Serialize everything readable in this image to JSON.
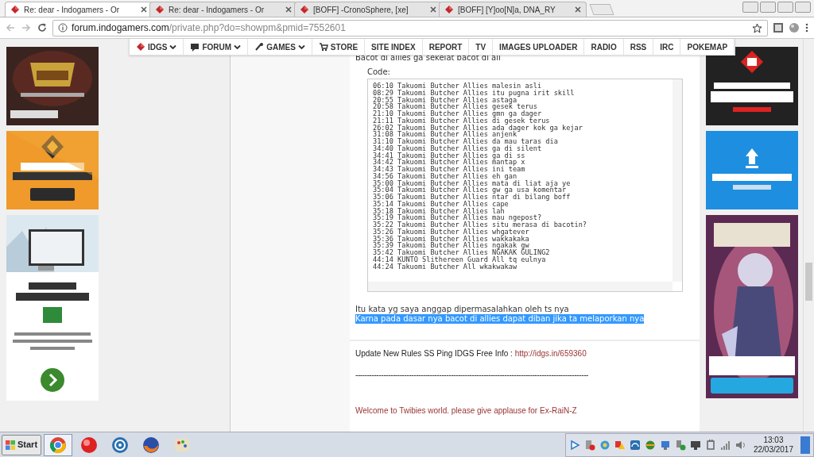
{
  "browser": {
    "tabs": [
      {
        "title": "Re: dear - Indogamers - Or",
        "selected": true
      },
      {
        "title": "Re: dear - Indogamers - Or",
        "selected": false
      },
      {
        "title": "[BOFF] -CronoSphere, [xe]",
        "selected": false
      },
      {
        "title": "[BOFF] [Y]oo[N]a, DNA_RY",
        "selected": false
      }
    ],
    "address": {
      "host": "forum.indogamers.com",
      "path": "/private.php?do=showpm&pmid=7552601"
    }
  },
  "nav": [
    {
      "label": "IDGS",
      "kind": "logo",
      "dropdown": true
    },
    {
      "label": "FORUM",
      "kind": "chat",
      "dropdown": true
    },
    {
      "label": "GAMES",
      "kind": "games",
      "dropdown": true
    },
    {
      "label": "STORE",
      "kind": "cart",
      "dropdown": false
    },
    {
      "label": "SITE INDEX",
      "kind": "plain",
      "dropdown": false
    },
    {
      "label": "REPORT",
      "kind": "plain",
      "dropdown": false
    },
    {
      "label": "TV",
      "kind": "plain",
      "dropdown": false
    },
    {
      "label": "IMAGES UPLOADER",
      "kind": "plain",
      "dropdown": false
    },
    {
      "label": "RADIO",
      "kind": "plain",
      "dropdown": false
    },
    {
      "label": "RSS",
      "kind": "plain",
      "dropdown": false
    },
    {
      "label": "IRC",
      "kind": "plain",
      "dropdown": false
    },
    {
      "label": "POKEMAP",
      "kind": "plain",
      "dropdown": false
    }
  ],
  "post": {
    "intro": "Bacot di allies ga sekelat bacot di all",
    "code_label": "Code:",
    "code_lines": [
      "06:10 Takuomi Butcher Allies malesin asli",
      "08:29 Takuomi Butcher Allies itu pugna irit skill",
      "20:55 Takuomi Butcher Allies astaga",
      "20:58 Takuomi Butcher Allies gesek terus",
      "21:10 Takuomi Butcher Allies gmn ga dager",
      "21:11 Takuomi Butcher Allies di gesek terus",
      "26:02 Takuomi Butcher Allies ada dager kok ga kejar",
      "31:08 Takuomi Butcher Allies anjenk",
      "31:10 Takuomi Butcher Allies da mau taras dia",
      "34:40 Takuomi Butcher Allies ga di silent",
      "34:41 Takuomi Butcher Allies ga di ss",
      "34:42 Takuomi Butcher Allies mantap x",
      "34:43 Takuomi Butcher Allies ini team",
      "34:56 Takuomi Butcher Allies eh gan",
      "35:00 Takuomi Butcher Allies mata di liat aja ye",
      "35:04 Takuomi Butcher Allies gw ga usa komentar",
      "35:06 Takuomi Butcher Allies ntar di bilang boff",
      "35:14 Takuomi Butcher Allies cape",
      "35:18 Takuomi Butcher Allies lah",
      "35:19 Takuomi Butcher Allies mau ngepost?",
      "35:22 Takuomi Butcher Allies situ merasa di bacotin?",
      "35:26 Takuomi Butcher Allies whgatever",
      "35:36 Takuomi Butcher Allies wakkakaka",
      "35:39 Takuomi Butcher Allies ngakak gw",
      "35:42 Takuomi Butcher Allies NGAKAK GULING2",
      "44:14 KUNTO Slithereen Guard All tq eulnya",
      "44:24 Takuomi Butcher All wkakwakaw"
    ],
    "lines": [
      {
        "text": "Itu kata yg saya anggap dipermasalahkan oleh ts nya",
        "selected": false
      },
      {
        "text": "Karna pada dasar nya bacot di allies dapat diban jika ta melaporkan nya",
        "selected": true
      }
    ]
  },
  "signature": {
    "info": "Update New Rules SS Ping IDGS Free Info : ",
    "link": "http://idgs.in/659360",
    "separator": "----------------------------------------------------------------------------------------------------",
    "welcome": "Welcome to Twibies world. please give applause for Ex-RaiN-Z"
  },
  "taskbar": {
    "start": "Start",
    "time": "13:03",
    "date": "22/03/2017"
  }
}
